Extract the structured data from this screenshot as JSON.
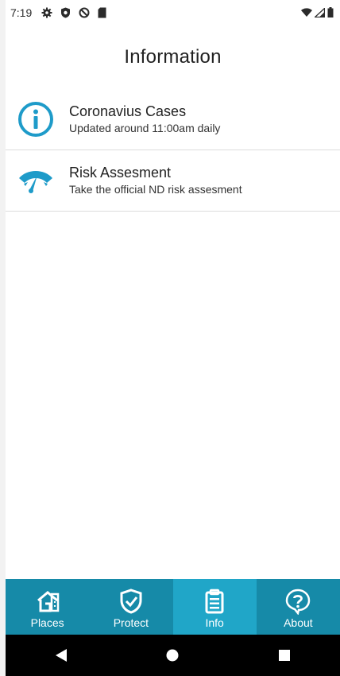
{
  "status_bar": {
    "time": "7:19",
    "left_icons": [
      "gear-icon",
      "shield-icon",
      "do-not-disturb-icon",
      "sd-card-icon"
    ],
    "right_icons": [
      "wifi-icon",
      "signal-icon",
      "battery-icon"
    ]
  },
  "header": {
    "title": "Information"
  },
  "items": [
    {
      "title": "Coronavius Cases",
      "subtitle": "Updated around 11:00am daily",
      "icon": "info-circle-icon"
    },
    {
      "title": "Risk Assesment",
      "subtitle": "Take the official ND risk assesment",
      "icon": "gauge-icon"
    }
  ],
  "bottom_nav": {
    "tabs": [
      {
        "label": "Places",
        "icon": "house-icon",
        "active": false
      },
      {
        "label": "Protect",
        "icon": "shield-check-icon",
        "active": false
      },
      {
        "label": "Info",
        "icon": "clipboard-icon",
        "active": true
      },
      {
        "label": "About",
        "icon": "question-bubble-icon",
        "active": false
      }
    ]
  },
  "system_nav": {
    "buttons": [
      "back-icon",
      "home-icon",
      "recents-icon"
    ]
  },
  "colors": {
    "accent": "#168aa8",
    "accent_active": "#20a6c8",
    "icon_blue": "#1e9bc9"
  }
}
